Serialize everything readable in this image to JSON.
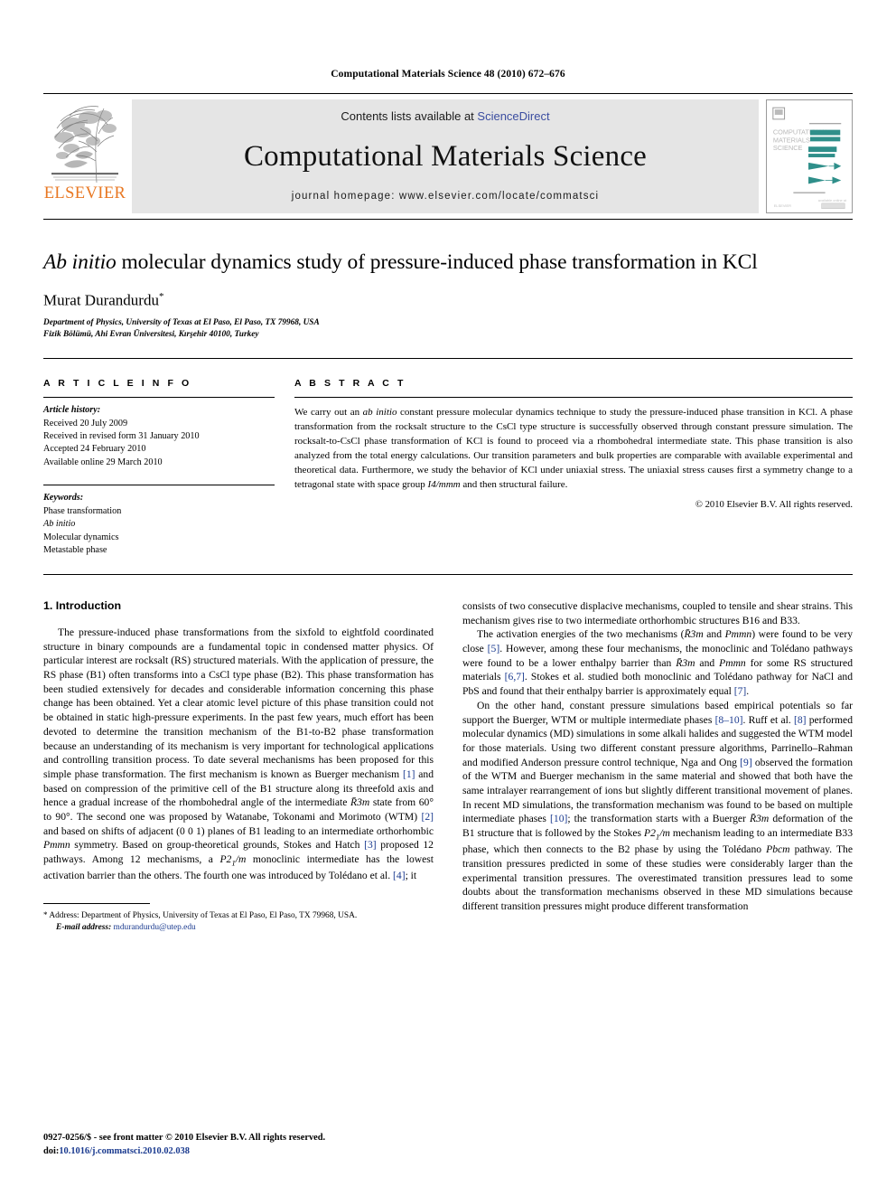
{
  "running_head": "Computational Materials Science 48 (2010) 672–676",
  "banner": {
    "publisher_word": "ELSEVIER",
    "contents_prefix": "Contents lists available at ",
    "contents_link": "ScienceDirect",
    "journal_title": "Computational Materials Science",
    "homepage": "journal homepage: www.elsevier.com/locate/commatsci",
    "cover_title_lines": [
      "COMPUTATIONAL",
      "MATERIALS",
      "SCIENCE"
    ],
    "accent_color": "#E87722",
    "link_color": "#3b4da0",
    "cover_graphic_color": "#2f8f8a"
  },
  "article": {
    "title_italic": "Ab initio",
    "title_rest": " molecular dynamics study of pressure-induced phase transformation in KCl",
    "author": "Murat Durandurdu",
    "author_mark": "*",
    "affiliations": [
      "Department of Physics, University of Texas at El Paso, El Paso, TX 79968, USA",
      "Fizik Bölümü, Ahi Evran Üniversitesi, Kırşehir 40100, Turkey"
    ]
  },
  "article_info": {
    "heading": "A R T I C L E  I N F O",
    "history_label": "Article history:",
    "history": [
      "Received 20 July 2009",
      "Received in revised form 31 January 2010",
      "Accepted 24 February 2010",
      "Available online 29 March 2010"
    ],
    "keywords_label": "Keywords:",
    "keywords": [
      "Phase transformation",
      "Ab initio",
      "Molecular dynamics",
      "Metastable phase"
    ]
  },
  "abstract": {
    "heading": "A B S T R A C T",
    "part1": "We carry out an ",
    "italic1": "ab initio",
    "part2": " constant pressure molecular dynamics technique to study the pressure-induced phase transition in KCl. A phase transformation from the rocksalt structure to the CsCl type structure is successfully observed through constant pressure simulation. The rocksalt-to-CsCl phase transformation of KCl is found to proceed via a rhombohedral intermediate state. This phase transition is also analyzed from the total energy calculations. Our transition parameters and bulk properties are comparable with available experimental and theoretical data. Furthermore, we study the behavior of KCl under uniaxial stress. The uniaxial stress causes first a symmetry change to a tetragonal state with space group ",
    "italic2": "I4/mmm",
    "part3": " and then structural failure.",
    "copyright": "© 2010 Elsevier B.V. All rights reserved."
  },
  "body": {
    "section_heading": "1. Introduction",
    "left_paragraphs": [
      {
        "runs": [
          {
            "t": "The pressure-induced phase transformations from the sixfold to eightfold coordinated structure in binary compounds are a fundamental topic in condensed matter physics. Of particular interest are rocksalt (RS) structured materials. With the application of pressure, the RS phase (B1) often transforms into a CsCl type phase (B2). This phase transformation has been studied extensively for decades and considerable information concerning this phase change has been obtained. Yet a clear atomic level picture of this phase transition could not be obtained in static high-pressure experiments. In the past few years, much effort has been devoted to determine the transition mechanism of the B1-to-B2 phase transformation because an understanding of its mechanism is very important for technological applications and controlling transition process. To date several mechanisms has been proposed for this simple phase transformation. The first mechanism is known as Buerger mechanism "
          },
          {
            "t": "[1]",
            "k": "ref"
          },
          {
            "t": " and based on compression of the primitive cell of the B1 structure along its threefold axis and hence a gradual increase of the rhombohedral angle of the intermediate "
          },
          {
            "t": "R̄3m",
            "k": "em"
          },
          {
            "t": " state from 60° to 90°. The second one was proposed by Watanabe, Tokonami and Morimoto (WTM) "
          },
          {
            "t": "[2]",
            "k": "ref"
          },
          {
            "t": " and based on shifts of adjacent (0 0 1) planes of B1 leading to an intermediate orthorhombic "
          },
          {
            "t": "Pmmn",
            "k": "em"
          },
          {
            "t": " symmetry. Based on group-theoretical grounds, Stokes and Hatch "
          },
          {
            "t": "[3]",
            "k": "ref"
          },
          {
            "t": " proposed 12 pathways. Among 12 mechanisms, a "
          },
          {
            "t": "P2",
            "k": "em"
          },
          {
            "t": "1",
            "k": "sub-em"
          },
          {
            "t": "/m",
            "k": "em"
          },
          {
            "t": " monoclinic intermediate has the lowest activation barrier than the others. The fourth one was introduced by Tolédano et al. "
          },
          {
            "t": "[4]",
            "k": "ref"
          },
          {
            "t": "; it"
          }
        ]
      }
    ],
    "right_paragraphs": [
      {
        "runs": [
          {
            "t": "consists of two consecutive displacive mechanisms, coupled to tensile and shear strains. This mechanism gives rise to two intermediate orthorhombic structures B16 and B33.",
            "k": "plain-noindent"
          }
        ]
      },
      {
        "runs": [
          {
            "t": "The activation energies of the two mechanisms ("
          },
          {
            "t": "R̄3m",
            "k": "em"
          },
          {
            "t": " and "
          },
          {
            "t": "Pmmn",
            "k": "em"
          },
          {
            "t": ") were found to be very close "
          },
          {
            "t": "[5]",
            "k": "ref"
          },
          {
            "t": ". However, among these four mechanisms, the monoclinic and Tolédano pathways were found to be a lower enthalpy barrier than "
          },
          {
            "t": "R̄3m",
            "k": "em"
          },
          {
            "t": " and "
          },
          {
            "t": "Pmmn",
            "k": "em"
          },
          {
            "t": " for some RS structured materials "
          },
          {
            "t": "[6,7]",
            "k": "ref"
          },
          {
            "t": ". Stokes et al. studied both monoclinic and Tolédano pathway for NaCl and PbS and found that their enthalpy barrier is approximately equal "
          },
          {
            "t": "[7]",
            "k": "ref"
          },
          {
            "t": "."
          }
        ]
      },
      {
        "runs": [
          {
            "t": "On the other hand, constant pressure simulations based empirical potentials so far support the Buerger, WTM or multiple intermediate phases "
          },
          {
            "t": "[8–10]",
            "k": "ref"
          },
          {
            "t": ". Ruff et al. "
          },
          {
            "t": "[8]",
            "k": "ref"
          },
          {
            "t": " performed molecular dynamics (MD) simulations in some alkali halides and suggested the WTM model for those materials. Using two different constant pressure algorithms, Parrinello–Rahman and modified Anderson pressure control technique, Nga and Ong "
          },
          {
            "t": "[9]",
            "k": "ref"
          },
          {
            "t": " observed the formation of the WTM and Buerger mechanism in the same material and showed that both have the same intralayer rearrangement of ions but slightly different transitional movement of planes. In recent MD simulations, the transformation mechanism was found to be based on multiple intermediate phases "
          },
          {
            "t": "[10]",
            "k": "ref"
          },
          {
            "t": "; the transformation starts with a Buerger "
          },
          {
            "t": "R̄3m",
            "k": "em"
          },
          {
            "t": " deformation of the B1 structure that is followed by the Stokes "
          },
          {
            "t": "P2",
            "k": "em"
          },
          {
            "t": "1",
            "k": "sub-em"
          },
          {
            "t": "/m",
            "k": "em"
          },
          {
            "t": " mechanism leading to an intermediate B33 phase, which then connects to the B2 phase by using the Tolédano "
          },
          {
            "t": "Pbcm",
            "k": "em"
          },
          {
            "t": " pathway. The transition pressures predicted in some of these studies were considerably larger than the experimental transition pressures. The overestimated transition pressures lead to some doubts about the transformation mechanisms observed in these MD simulations because different transition pressures might produce different transformation"
          }
        ]
      }
    ]
  },
  "footnote": {
    "mark": "*",
    "address": " Address: Department of Physics, University of Texas at El Paso, El Paso, TX 79968, USA.",
    "email_label": "E-mail address:",
    "email": "mdurandurdu@utep.edu"
  },
  "imprint": {
    "line1": "0927-0256/$ - see front matter © 2010 Elsevier B.V. All rights reserved.",
    "doi_label": "doi:",
    "doi_value": "10.1016/j.commatsci.2010.02.038"
  }
}
